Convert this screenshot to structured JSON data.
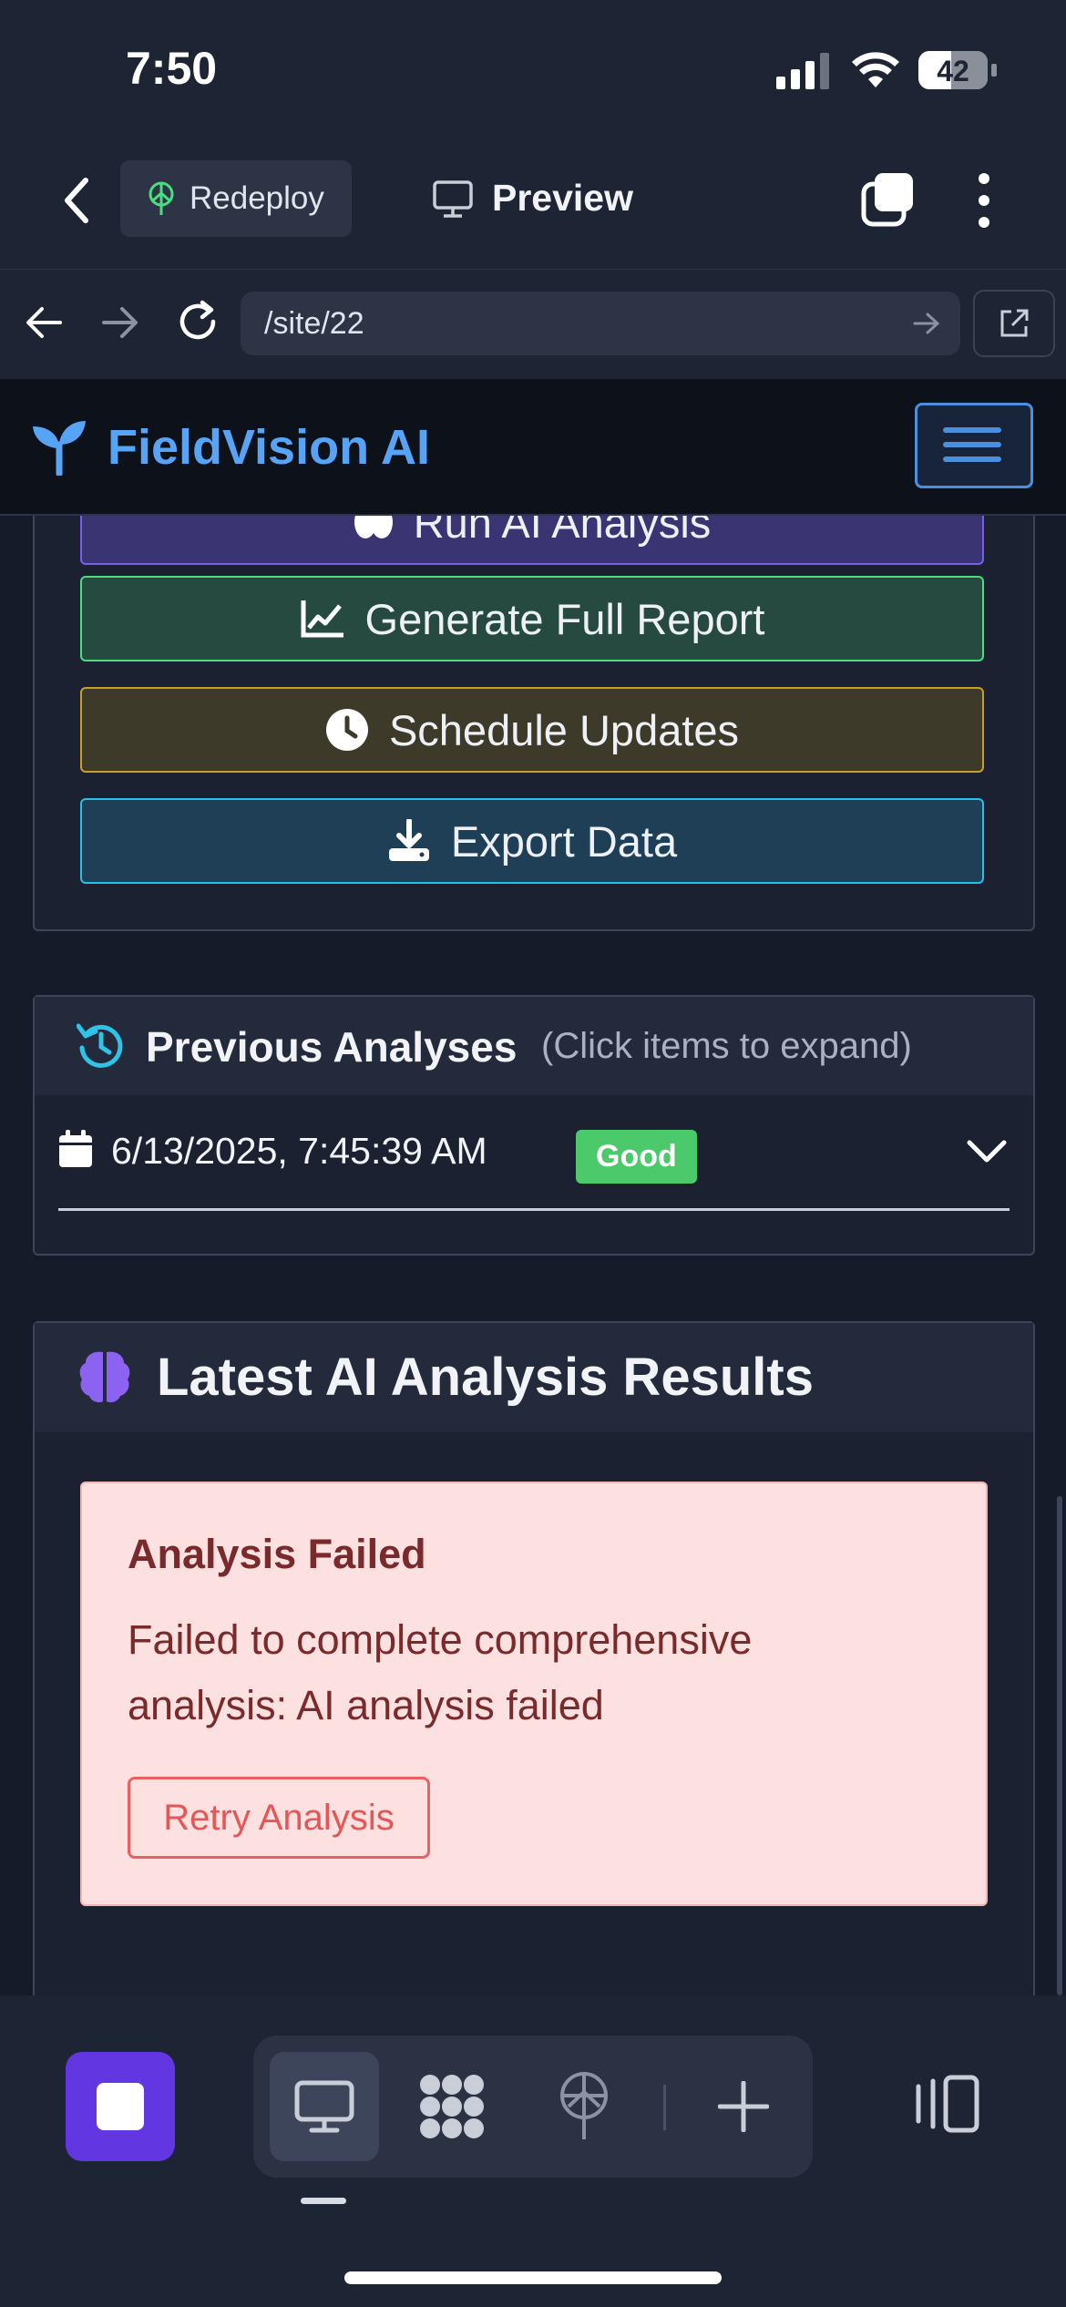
{
  "status": {
    "time": "7:50",
    "battery": "42"
  },
  "topbar": {
    "redeploy_label": "Redeploy",
    "preview_label": "Preview"
  },
  "urlbar": {
    "url": "/site/22"
  },
  "app": {
    "brand": "FieldVision AI"
  },
  "actions": {
    "run_label": "Run AI Analysis",
    "generate_label": "Generate Full Report",
    "schedule_label": "Schedule Updates",
    "export_label": "Export Data"
  },
  "history": {
    "title": "Previous Analyses",
    "hint": "(Click items to expand)",
    "items": [
      {
        "timestamp": "6/13/2025, 7:45:39 AM",
        "status": "Good"
      }
    ]
  },
  "latest": {
    "title": "Latest AI Analysis Results",
    "alert_title": "Analysis Failed",
    "alert_message": "Failed to complete comprehensive analysis: AI analysis failed",
    "retry_label": "Retry Analysis"
  },
  "colors": {
    "accent": "#57a3f5",
    "run": "#7c5cf0",
    "generate": "#4ade80",
    "schedule": "#c8a028",
    "export": "#22c3e6",
    "good": "#4cc96b",
    "error": "#e65656"
  }
}
